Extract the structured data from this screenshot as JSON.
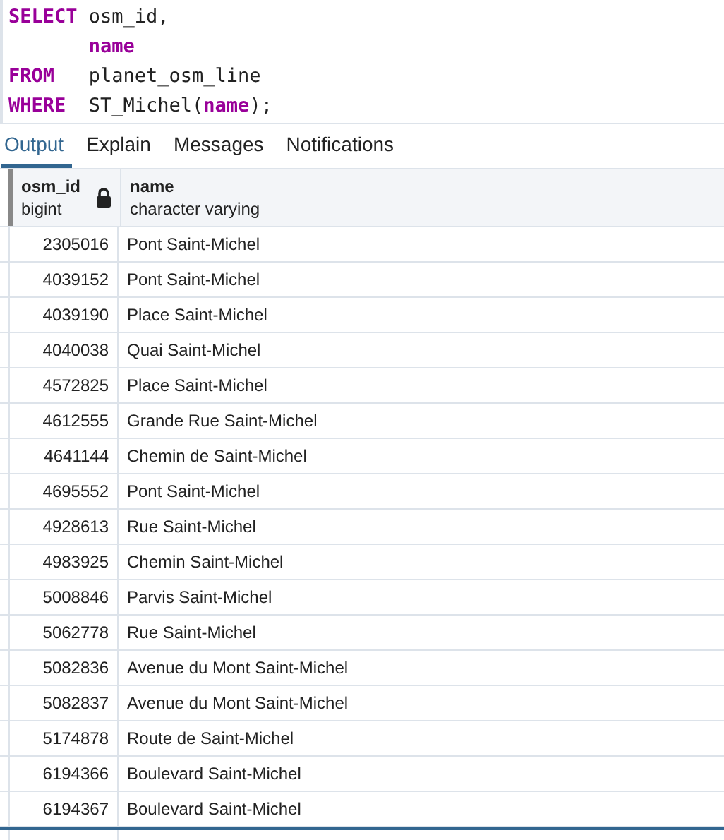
{
  "editor": {
    "lines": [
      {
        "keyword": "SELECT",
        "tokens": [
          {
            "kind": "plain",
            "text": "osm_id,"
          }
        ]
      },
      {
        "tokens": [
          {
            "kind": "keyword",
            "text": "name"
          }
        ]
      },
      {
        "keyword": "FROM",
        "tokens": [
          {
            "kind": "plain",
            "text": "planet_osm_line"
          }
        ]
      },
      {
        "keyword": "WHERE",
        "tokens": [
          {
            "kind": "plain",
            "text": "ST_Michel("
          },
          {
            "kind": "keyword",
            "text": "name"
          },
          {
            "kind": "plain",
            "text": ");"
          }
        ]
      }
    ]
  },
  "tabs": [
    {
      "label": "Output",
      "selected": true
    },
    {
      "label": "Explain",
      "selected": false
    },
    {
      "label": "Messages",
      "selected": false
    },
    {
      "label": "Notifications",
      "selected": false
    }
  ],
  "table": {
    "columns": [
      {
        "name": "osm_id",
        "type": "bigint",
        "locked": true
      },
      {
        "name": "name",
        "type": "character varying",
        "locked": false
      }
    ],
    "rows": [
      [
        "2305016",
        "Pont Saint-Michel"
      ],
      [
        "4039152",
        "Pont Saint-Michel"
      ],
      [
        "4039190",
        "Place Saint-Michel"
      ],
      [
        "4040038",
        "Quai Saint-Michel"
      ],
      [
        "4572825",
        "Place Saint-Michel"
      ],
      [
        "4612555",
        "Grande Rue Saint-Michel"
      ],
      [
        "4641144",
        "Chemin de Saint-Michel"
      ],
      [
        "4695552",
        "Pont Saint-Michel"
      ],
      [
        "4928613",
        "Rue Saint-Michel"
      ],
      [
        "4983925",
        "Chemin Saint-Michel"
      ],
      [
        "5008846",
        "Parvis Saint-Michel"
      ],
      [
        "5062778",
        "Rue Saint-Michel"
      ],
      [
        "5082836",
        "Avenue du Mont Saint-Michel"
      ],
      [
        "5082837",
        "Avenue du Mont Saint-Michel"
      ],
      [
        "5174878",
        "Route de Saint-Michel"
      ],
      [
        "6194366",
        "Boulevard Saint-Michel"
      ],
      [
        "6194367",
        "Boulevard Saint-Michel"
      ]
    ]
  }
}
